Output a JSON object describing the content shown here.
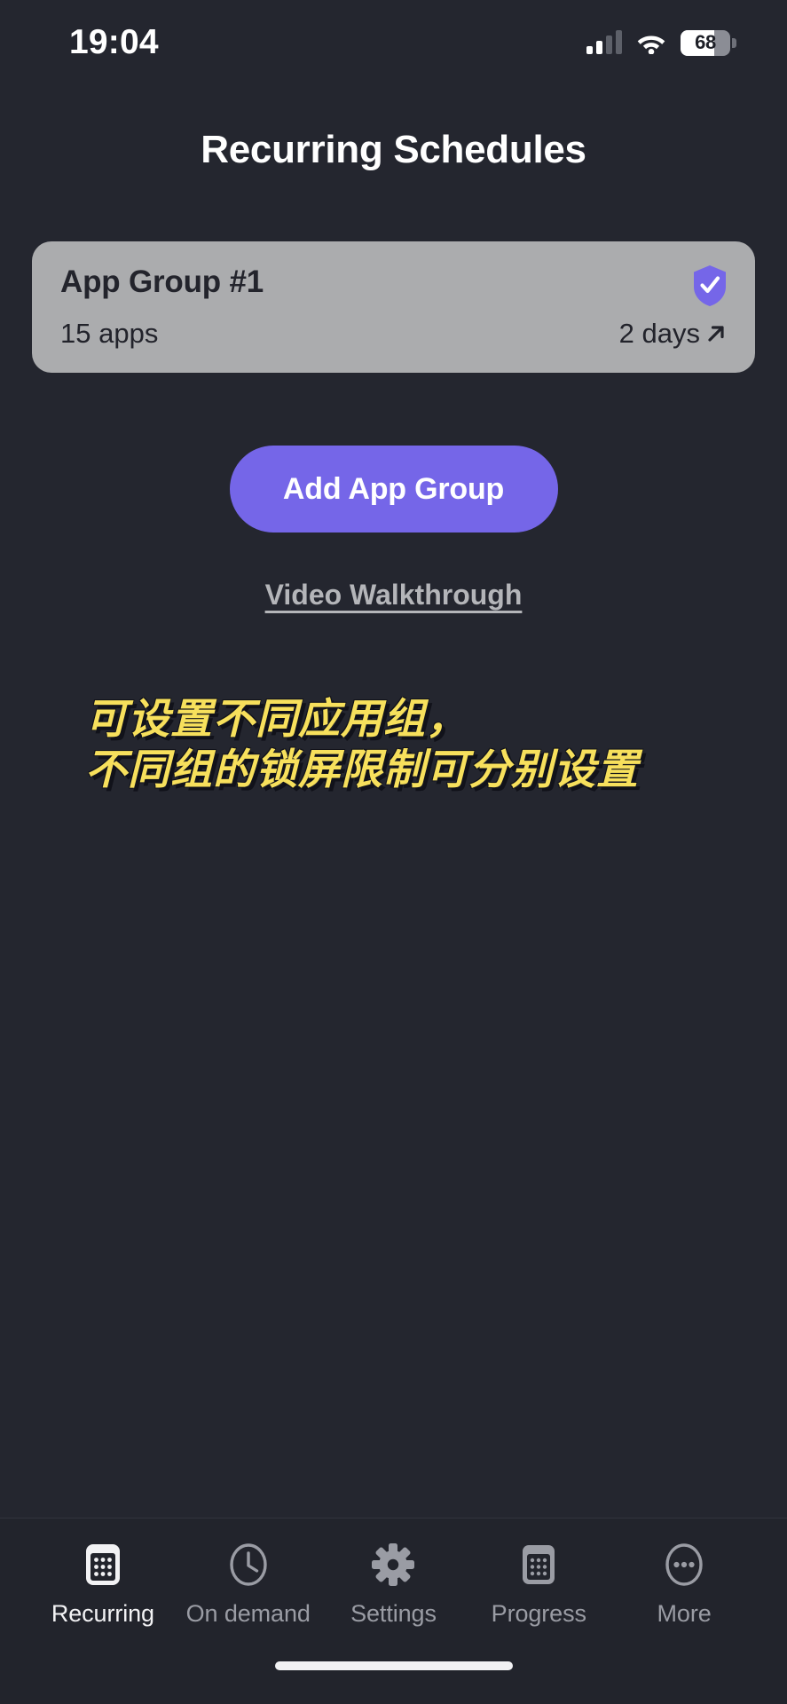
{
  "status_bar": {
    "time": "19:04",
    "battery_percent": "68",
    "signal_icon": "cellular-signal-icon",
    "wifi_icon": "wifi-icon",
    "battery_icon": "battery-icon"
  },
  "header": {
    "title": "Recurring Schedules"
  },
  "group_card": {
    "name": "App Group #1",
    "apps_count": "15 apps",
    "duration": "2 days",
    "shield_icon": "shield-check-icon",
    "open_arrow_icon": "arrow-up-right-icon"
  },
  "actions": {
    "add_group_label": "Add App Group",
    "video_link_label": "Video Walkthrough"
  },
  "caption": {
    "line1": "可设置不同应用组，",
    "line2": "不同组的锁屏限制可分别设置"
  },
  "tab_bar": {
    "items": [
      {
        "label": "Recurring",
        "icon": "calendar-grid-filled-icon",
        "active": true
      },
      {
        "label": "On demand",
        "icon": "clock-icon",
        "active": false
      },
      {
        "label": "Settings",
        "icon": "gear-icon",
        "active": false
      },
      {
        "label": "Progress",
        "icon": "calendar-grid-icon",
        "active": false
      },
      {
        "label": "More",
        "icon": "ellipsis-circle-icon",
        "active": false
      }
    ]
  },
  "colors": {
    "background": "#24262f",
    "accent_purple": "#7566e8",
    "card_gray": "#abacae",
    "caption_yellow": "#f7e05c"
  }
}
